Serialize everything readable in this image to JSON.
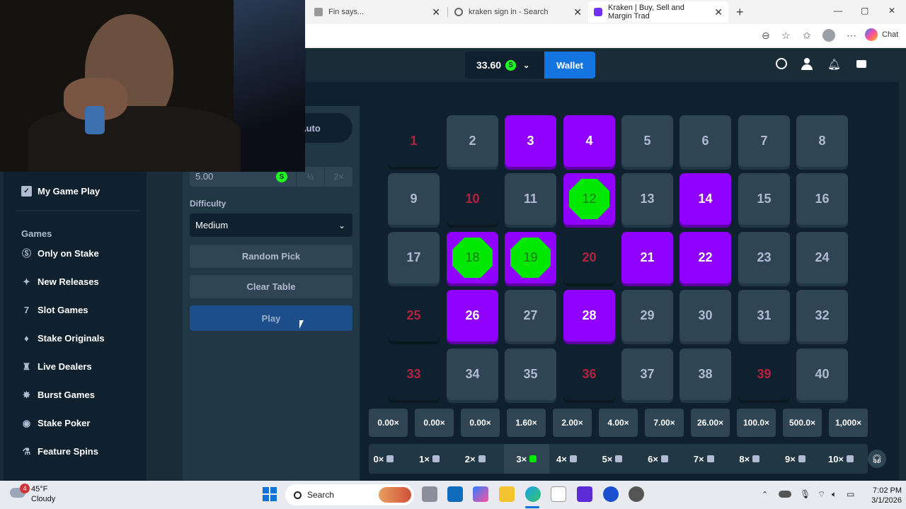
{
  "browser": {
    "tabs": [
      {
        "title": "Fin says..."
      },
      {
        "title": "kraken sign in - Search"
      },
      {
        "title": "Kraken | Buy, Sell and Margin Trad"
      }
    ],
    "chat_label": "Chat"
  },
  "topbar": {
    "balance": "33.60",
    "currency_symbol": "S",
    "wallet_label": "Wallet"
  },
  "sidebar": {
    "my_game_play": "My Game Play",
    "games_header": "Games",
    "items": [
      {
        "label": "Only on Stake",
        "icon": "stake-icon"
      },
      {
        "label": "New Releases",
        "icon": "sparkle-icon"
      },
      {
        "label": "Slot Games",
        "icon": "slot-icon"
      },
      {
        "label": "Stake Originals",
        "icon": "flame-icon"
      },
      {
        "label": "Live Dealers",
        "icon": "dealer-icon"
      },
      {
        "label": "Burst Games",
        "icon": "burst-icon"
      },
      {
        "label": "Stake Poker",
        "icon": "poker-icon"
      },
      {
        "label": "Feature Spins",
        "icon": "spins-icon"
      }
    ]
  },
  "controls": {
    "auto_tab": "Auto",
    "bet_amount": "5.00",
    "half_label": "½",
    "double_label": "2×",
    "difficulty_label": "Difficulty",
    "difficulty_value": "Medium",
    "random_pick": "Random Pick",
    "clear_table": "Clear Table",
    "play": "Play"
  },
  "board": {
    "tiles": [
      {
        "n": "1",
        "state": "miss"
      },
      {
        "n": "2",
        "state": "normal"
      },
      {
        "n": "3",
        "state": "selected"
      },
      {
        "n": "4",
        "state": "selected"
      },
      {
        "n": "5",
        "state": "normal"
      },
      {
        "n": "6",
        "state": "normal"
      },
      {
        "n": "7",
        "state": "normal"
      },
      {
        "n": "8",
        "state": "normal"
      },
      {
        "n": "9",
        "state": "normal"
      },
      {
        "n": "10",
        "state": "miss"
      },
      {
        "n": "11",
        "state": "normal"
      },
      {
        "n": "12",
        "state": "hit"
      },
      {
        "n": "13",
        "state": "normal"
      },
      {
        "n": "14",
        "state": "selected"
      },
      {
        "n": "15",
        "state": "normal"
      },
      {
        "n": "16",
        "state": "normal"
      },
      {
        "n": "17",
        "state": "normal"
      },
      {
        "n": "18",
        "state": "hit"
      },
      {
        "n": "19",
        "state": "hit"
      },
      {
        "n": "20",
        "state": "miss"
      },
      {
        "n": "21",
        "state": "selected"
      },
      {
        "n": "22",
        "state": "selected"
      },
      {
        "n": "23",
        "state": "normal"
      },
      {
        "n": "24",
        "state": "normal"
      },
      {
        "n": "25",
        "state": "miss"
      },
      {
        "n": "26",
        "state": "selected"
      },
      {
        "n": "27",
        "state": "normal"
      },
      {
        "n": "28",
        "state": "selected"
      },
      {
        "n": "29",
        "state": "normal"
      },
      {
        "n": "30",
        "state": "normal"
      },
      {
        "n": "31",
        "state": "normal"
      },
      {
        "n": "32",
        "state": "normal"
      },
      {
        "n": "33",
        "state": "miss"
      },
      {
        "n": "34",
        "state": "normal"
      },
      {
        "n": "35",
        "state": "normal"
      },
      {
        "n": "36",
        "state": "miss"
      },
      {
        "n": "37",
        "state": "normal"
      },
      {
        "n": "38",
        "state": "normal"
      },
      {
        "n": "39",
        "state": "miss"
      },
      {
        "n": "40",
        "state": "normal"
      }
    ],
    "payouts": [
      "0.00×",
      "0.00×",
      "0.00×",
      "1.60×",
      "2.00×",
      "4.00×",
      "7.00×",
      "26.00×",
      "100.0×",
      "500.0×",
      "1,000×"
    ],
    "hits": [
      "0×",
      "1×",
      "2×",
      "3×",
      "4×",
      "5×",
      "6×",
      "7×",
      "8×",
      "9×",
      "10×"
    ],
    "active_hit_index": 3
  },
  "taskbar": {
    "weather_temp": "45°F",
    "weather_desc": "Cloudy",
    "weather_badge": "4",
    "search_label": "Search",
    "time": "7:02 PM",
    "date": "3/1/2026"
  },
  "colors": {
    "accent_purple": "#9000ff",
    "gem_green": "#00e701",
    "miss_red": "#b3233f",
    "wallet_blue": "#1475e1"
  }
}
